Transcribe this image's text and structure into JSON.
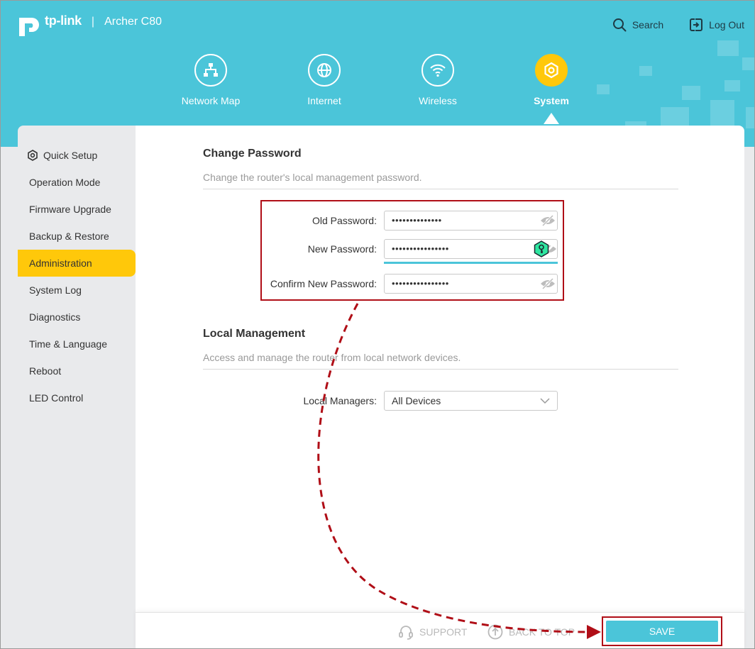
{
  "brand": {
    "logo_text": "tp-link",
    "separator": "|",
    "model": "Archer C80"
  },
  "top_actions": {
    "search": "Search",
    "logout": "Log Out"
  },
  "nav": [
    {
      "label": "Network Map",
      "icon": "network-map-icon"
    },
    {
      "label": "Internet",
      "icon": "globe-icon"
    },
    {
      "label": "Wireless",
      "icon": "wifi-icon"
    },
    {
      "label": "System",
      "icon": "gear-icon",
      "active": true
    }
  ],
  "sidebar": {
    "items": [
      {
        "label": "Quick Setup",
        "icon": "gear-icon"
      },
      {
        "label": "Operation Mode"
      },
      {
        "label": "Firmware Upgrade"
      },
      {
        "label": "Backup & Restore"
      },
      {
        "label": "Administration",
        "active": true
      },
      {
        "label": "System Log"
      },
      {
        "label": "Diagnostics"
      },
      {
        "label": "Time & Language"
      },
      {
        "label": "Reboot"
      },
      {
        "label": "LED Control"
      }
    ]
  },
  "change_password": {
    "title": "Change Password",
    "description": "Change the router's local management password.",
    "old_label": "Old Password:",
    "old_value": "••••••••••••••",
    "new_label": "New Password:",
    "new_value": "••••••••••••••••",
    "confirm_label": "Confirm New Password:",
    "confirm_value": "••••••••••••••••"
  },
  "local_management": {
    "title": "Local Management",
    "description": "Access and manage the router from local network devices.",
    "managers_label": "Local Managers:",
    "managers_value": "All Devices"
  },
  "footer": {
    "support": "SUPPORT",
    "back_to_top": "BACK TO TOP",
    "save": "SAVE"
  },
  "colors": {
    "header": "#4bc5d9",
    "accent": "#ffc80a",
    "highlight": "#b00e17",
    "save_button": "#4bc5d9"
  }
}
